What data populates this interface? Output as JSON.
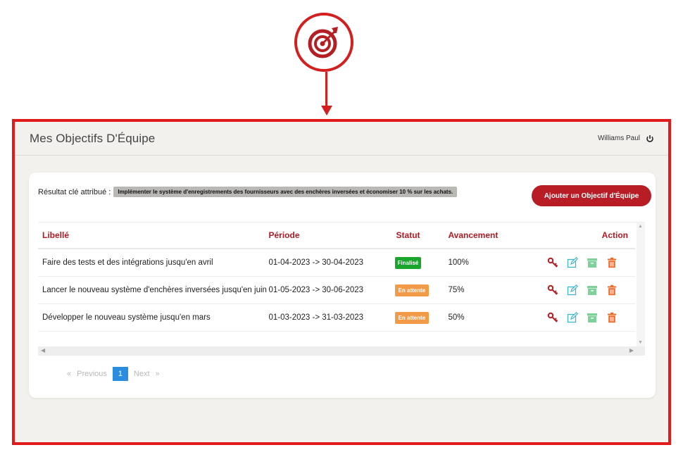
{
  "header": {
    "title": "Mes Objectifs D'Équipe",
    "user_name": "Williams Paul",
    "logout_icon": "power-icon"
  },
  "key_result": {
    "label": "Résultat clé attribué :",
    "value": "Implémenter le système d'enregistrements des fournisseurs avec des enchères inversées et économiser 10 % sur les achats."
  },
  "add_button": "Ajouter un Objectif d'Équipe",
  "table": {
    "columns": [
      "Libellé",
      "Période",
      "Statut",
      "Avancement",
      "Action"
    ],
    "rows": [
      {
        "label": "Faire des tests et des intégrations jusqu'en avril",
        "period": "01-04-2023 -> 30-04-2023",
        "status": "Finalisé",
        "progress": "100%"
      },
      {
        "label": "Lancer le nouveau système d'enchères inversées jusqu'en juin",
        "period": "01-05-2023 -> 30-06-2023",
        "status": "En attente",
        "progress": "75%"
      },
      {
        "label": "Développer le nouveau système jusqu'en mars",
        "period": "01-03-2023 -> 31-03-2023",
        "status": "En attente",
        "progress": "50%"
      }
    ],
    "action_icons": [
      "key-icon",
      "edit-icon",
      "archive-icon",
      "trash-icon"
    ]
  },
  "pagination": {
    "prev_arrow": "«",
    "previous": "Previous",
    "current": "1",
    "next": "Next",
    "next_arrow": "»"
  },
  "colors": {
    "frame": "#e11b1b",
    "accent": "#b81c24",
    "finalise": "#1aa52c",
    "attente": "#f39a48",
    "page": "#2a8de0"
  }
}
